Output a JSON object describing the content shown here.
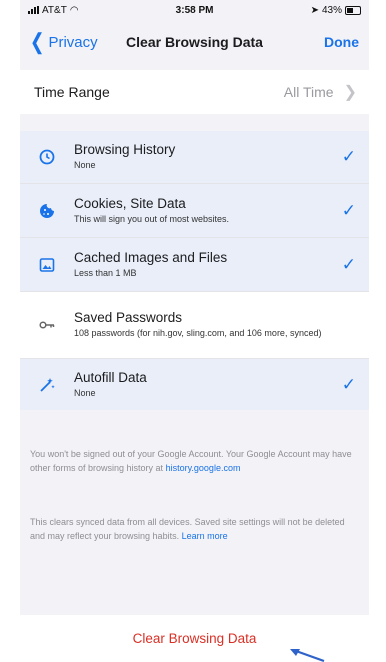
{
  "status_bar": {
    "carrier": "AT&T",
    "time": "3:58 PM",
    "battery": "43%"
  },
  "nav": {
    "back_label": "Privacy",
    "title": "Clear Browsing Data",
    "done_label": "Done"
  },
  "time_range": {
    "label": "Time Range",
    "value": "All Time"
  },
  "items": [
    {
      "title": "Browsing History",
      "subtitle": "None",
      "checked": true,
      "icon": "history-icon"
    },
    {
      "title": "Cookies, Site Data",
      "subtitle": "This will sign you out of most websites.",
      "checked": true,
      "icon": "cookie-icon"
    },
    {
      "title": "Cached Images and Files",
      "subtitle": "Less than 1 MB",
      "checked": true,
      "icon": "image-icon"
    },
    {
      "title": "Saved Passwords",
      "subtitle": "108 passwords (for nih.gov, sling.com, and 106 more, synced)",
      "checked": false,
      "icon": "key-icon"
    },
    {
      "title": "Autofill Data",
      "subtitle": "None",
      "checked": true,
      "icon": "autofill-icon"
    }
  ],
  "footer": {
    "note1_text": "You won't be signed out of your Google Account. Your Google Account may have other forms of browsing history at",
    "note1_link": "history.google.com",
    "note2_text": "This clears synced data from all devices. Saved site settings will not be deleted and may reflect your browsing habits.",
    "note2_link": "Learn more"
  },
  "clear_button": {
    "label": "Clear Browsing Data"
  },
  "colors": {
    "accent": "#1a73e8",
    "destructive": "#d93025",
    "selected_row": "#e9eef9"
  }
}
